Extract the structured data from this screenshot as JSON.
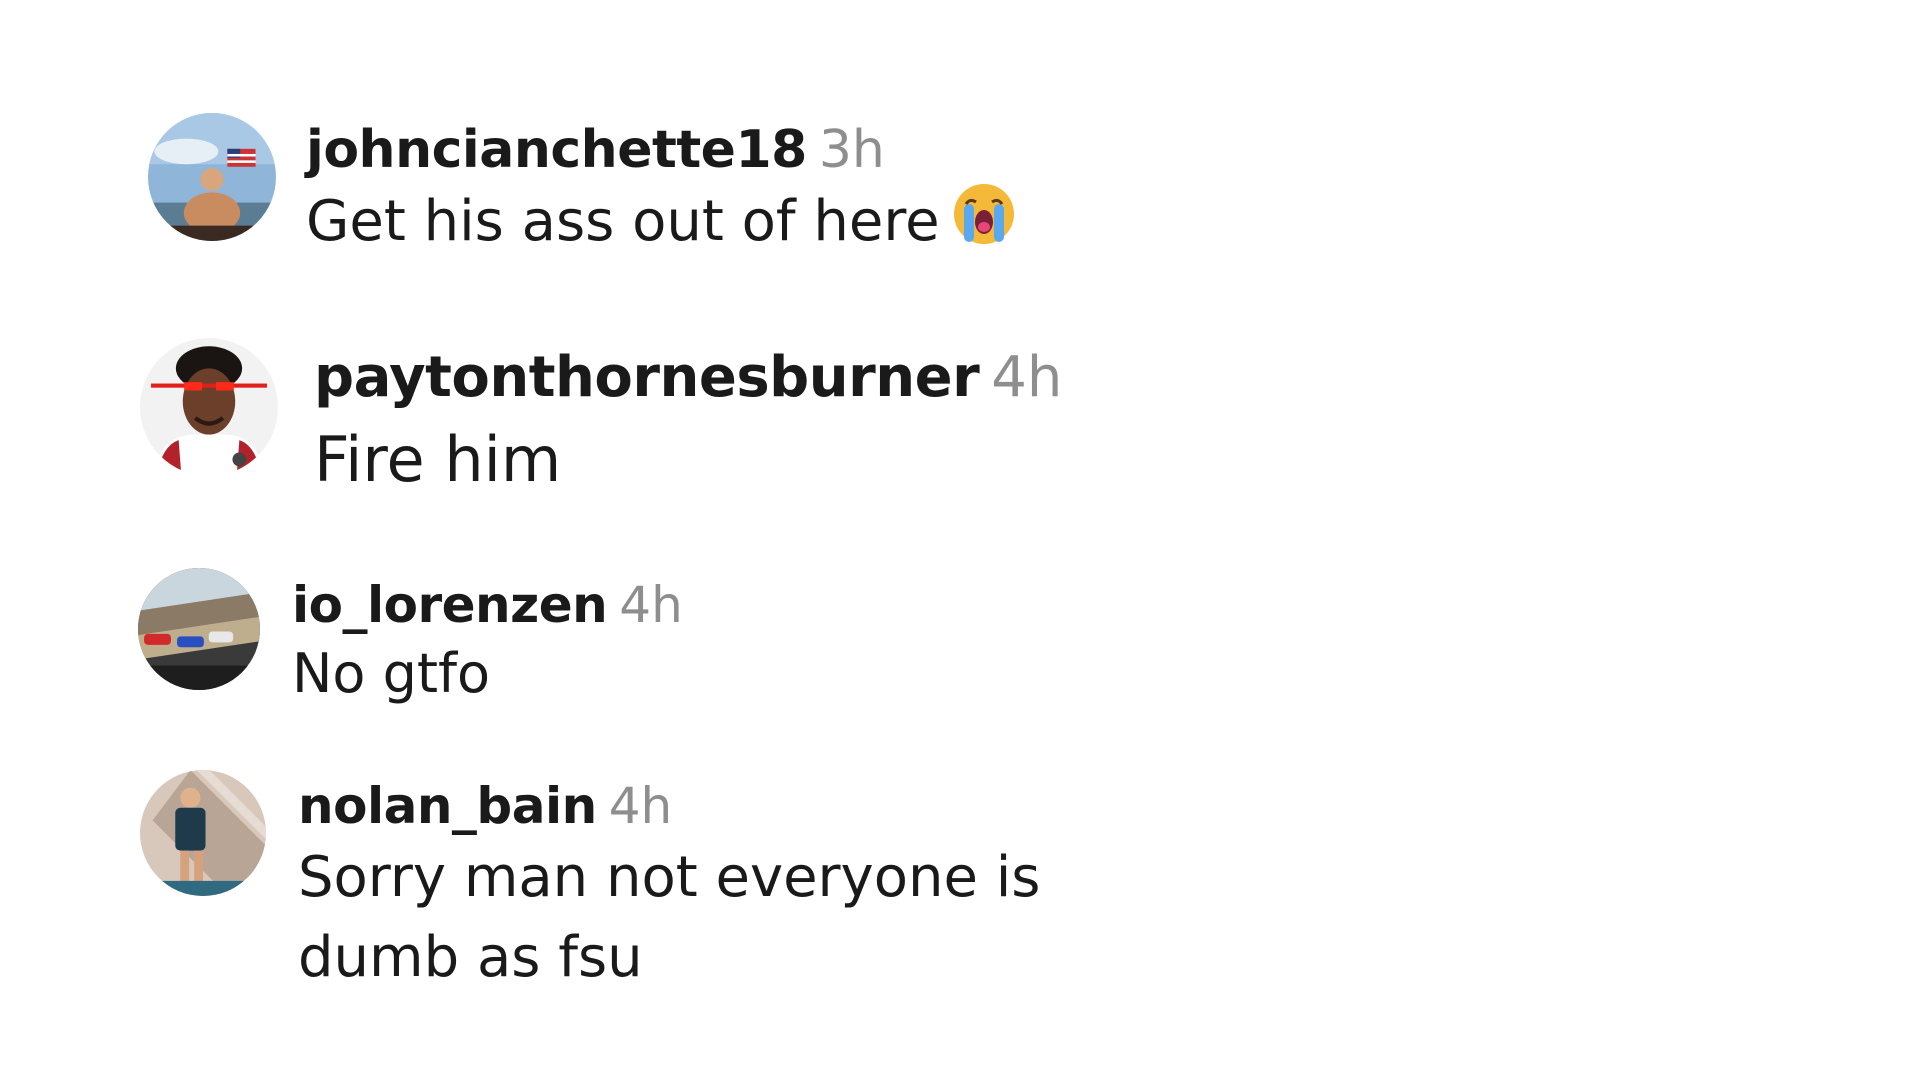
{
  "comments": [
    {
      "username": "johncianchette18",
      "timestamp": "3h",
      "text": "Get his ass out of here",
      "emoji": "loudly-crying-face-icon",
      "avatar": "avatar-man-on-boat-flag"
    },
    {
      "username": "paytonthornesburner",
      "timestamp": "4h",
      "text": "Fire him",
      "avatar": "avatar-basketball-player-laser-eyes"
    },
    {
      "username": "io_lorenzen",
      "timestamp": "4h",
      "text": "No gtfo",
      "avatar": "avatar-race-cars-track"
    },
    {
      "username": "nolan_bain",
      "timestamp": "4h",
      "text": "Sorry man not everyone is dumb as fsu",
      "avatar": "avatar-man-standing-wall"
    }
  ],
  "colors": {
    "username": "#1a1a1a",
    "timestamp": "#8e8e8e",
    "text": "#1a1a1a",
    "background": "#ffffff"
  }
}
